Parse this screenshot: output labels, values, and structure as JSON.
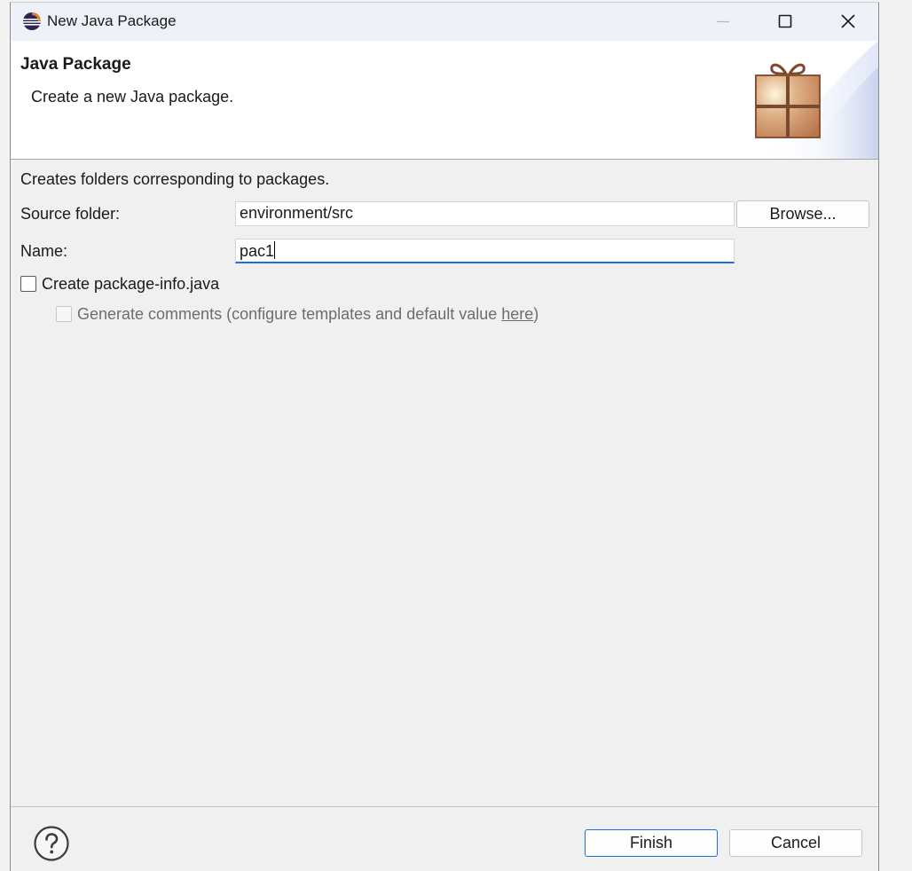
{
  "window": {
    "title": "New Java Package",
    "app_icon": "eclipse-icon",
    "controls": {
      "minimize": "minimize-icon",
      "maximize": "maximize-icon",
      "close": "close-icon"
    }
  },
  "header": {
    "title": "Java Package",
    "description": "Create a new Java package.",
    "image": "package-wizard-icon"
  },
  "form": {
    "intro": "Creates folders corresponding to packages.",
    "source_folder": {
      "label": "Source folder:",
      "value": "environment/src",
      "browse_label": "Browse..."
    },
    "name": {
      "label": "Name:",
      "value": "pac1"
    },
    "create_package_info": {
      "label": "Create package-info.java",
      "checked": false
    },
    "generate_comments": {
      "label": "Generate comments (configure templates and default value ",
      "link": "here",
      "suffix": ")",
      "checked": false,
      "enabled": false
    }
  },
  "footer": {
    "help_icon": "help-icon",
    "finish_label": "Finish",
    "cancel_label": "Cancel"
  },
  "colors": {
    "accent": "#1e6fd9",
    "package_brown": "#a9653c"
  }
}
